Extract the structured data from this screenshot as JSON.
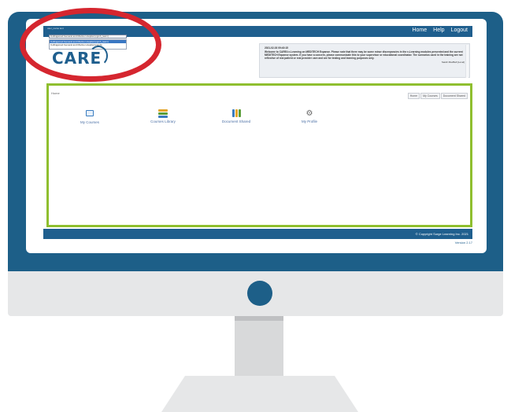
{
  "colors": {
    "brand": "#1f5f8e",
    "accent_green": "#8fbf2f",
    "highlight_red": "#d5262f",
    "monitor_body": "#1d5f88"
  },
  "header": {
    "user_label": "user_name text",
    "nav": [
      "Home",
      "Help",
      "Logout"
    ],
    "department_select": {
      "value": "Collingwood General and Marine Hospital (cgmh_learn)",
      "options": [
        "Collingwood General and Marine Hospital (cgmh_learn)",
        "Collingwood General and Marine Hospital (cgmh)"
      ]
    }
  },
  "logo": {
    "text": "CARE"
  },
  "announcement": {
    "date": "2021-02-03 09:40:15",
    "text": "Welcome to CARE4 e-Learning on MEDITECH Expanse. Please note that there may be some minor discrepancies in the e-Learning modules presented and the current MEDITECH Expanse system. If you have a concern, please communicate this to your supervisor or educational coordinator. The scenarios used in the training are not reflective of real patient or real provider care and are for testing and learning purposes only.",
    "signature": "Sarah MacBell [Level]"
  },
  "main": {
    "breadcrumb": "Home",
    "tabs": [
      "Home",
      "My Courses",
      "Document Shared"
    ],
    "tiles": [
      {
        "label": "My Courses",
        "icon": "book-icon"
      },
      {
        "label": "Courses Library",
        "icon": "stack-icon"
      },
      {
        "label": "Document Shared",
        "icon": "binders-icon"
      },
      {
        "label": "My Profile",
        "icon": "tools-icon"
      }
    ]
  },
  "footer": {
    "copyright": "© Copyright Surge Learning Inc. 2021",
    "version": "Version 2.17"
  }
}
